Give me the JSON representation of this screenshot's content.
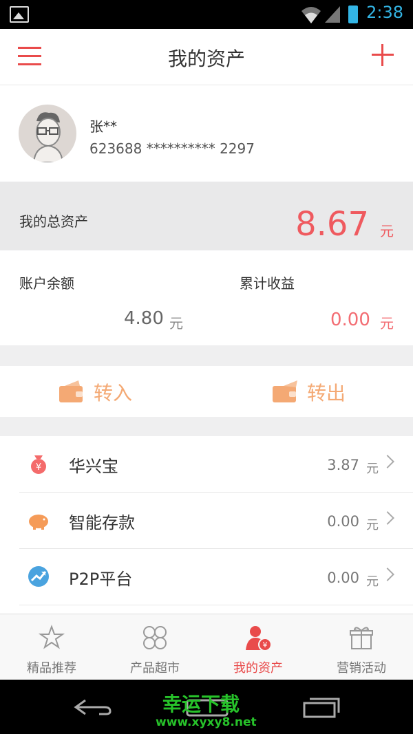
{
  "status_bar": {
    "time": "2:38",
    "color": "#33b5e5"
  },
  "header": {
    "title": "我的资产",
    "menu_icon": "hamburger-icon",
    "add_icon": "plus-icon",
    "accent": "#e94b4b"
  },
  "profile": {
    "name": "张**",
    "card_number": "623688 ********** 2297"
  },
  "total_assets": {
    "label": "我的总资产",
    "value": "8.67",
    "unit": "元"
  },
  "stats": {
    "balance_label": "账户余额",
    "balance_value": "4.80",
    "balance_unit": "元",
    "earnings_label": "累计收益",
    "earnings_value": "0.00",
    "earnings_unit": "元"
  },
  "actions": {
    "transfer_in": "转入",
    "transfer_out": "转出",
    "color": "#f4a974"
  },
  "products": [
    {
      "label": "华兴宝",
      "amount": "3.87",
      "unit": "元",
      "icon": "money-bag-icon"
    },
    {
      "label": "智能存款",
      "amount": "0.00",
      "unit": "元",
      "icon": "piggy-bank-icon"
    },
    {
      "label": "P2P平台",
      "amount": "0.00",
      "unit": "元",
      "icon": "growth-chart-icon"
    }
  ],
  "tabs": [
    {
      "label": "精品推荐",
      "icon": "star-icon",
      "active": false
    },
    {
      "label": "产品超市",
      "icon": "clover-grid-icon",
      "active": false
    },
    {
      "label": "我的资产",
      "icon": "user-yuan-icon",
      "active": true
    },
    {
      "label": "营销活动",
      "icon": "gift-icon",
      "active": false
    }
  ],
  "watermark": {
    "title": "幸运下载",
    "url": "www.xyxy8.net"
  }
}
